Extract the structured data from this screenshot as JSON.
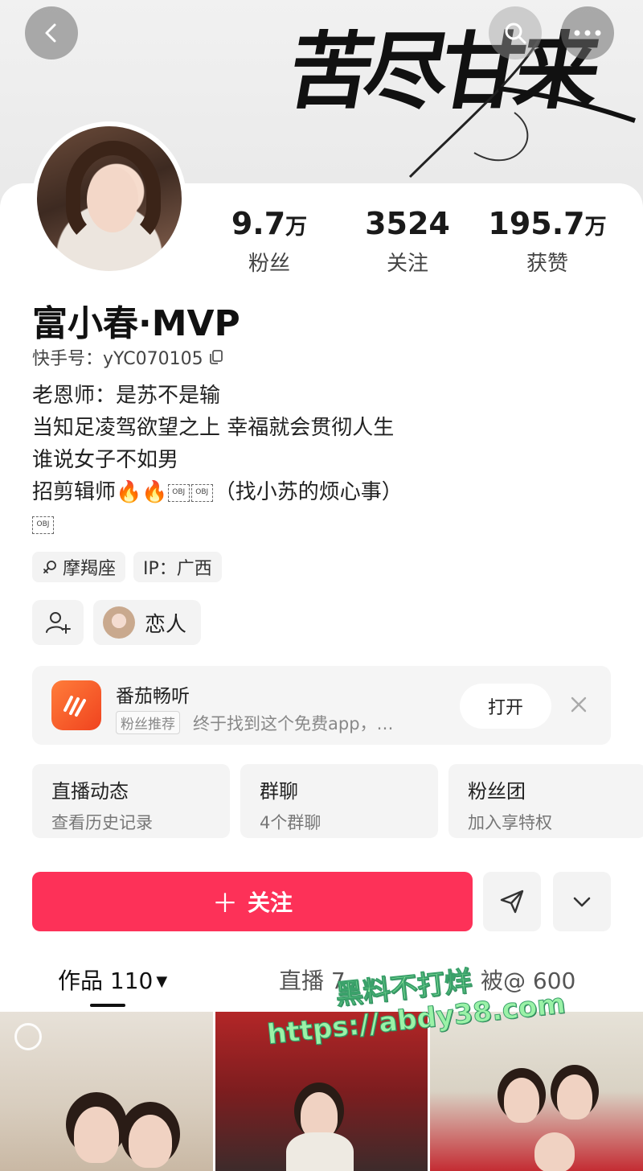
{
  "banner": {
    "calligraphy": "苦尽甘来"
  },
  "profile": {
    "name": "富小春·MVP",
    "kuaishou_id": "快手号：yYC070105",
    "stats": [
      {
        "value": "9.7",
        "unit": "万",
        "label": "粉丝"
      },
      {
        "value": "3524",
        "unit": "",
        "label": "关注"
      },
      {
        "value": "195.7",
        "unit": "万",
        "label": "获赞"
      }
    ],
    "bio": {
      "line1": "老恩师：是苏不是输",
      "line2": "当知足凌驾欲望之上 幸福就会贯彻人生",
      "line3": "谁说女子不如男",
      "line4": "招剪辑师🔥🔥",
      "line4_tail": "（找小苏的烦心事）",
      "obj_placeholder": "OBJ"
    },
    "tags": {
      "zodiac": "摩羯座",
      "ip": "IP：广西"
    },
    "relation_label": "恋人"
  },
  "ad": {
    "title": "番茄畅听",
    "badge": "粉丝推荐",
    "desc": "终于找到这个免费app，…",
    "open_label": "打开"
  },
  "features": [
    {
      "title": "直播动态",
      "subtitle": "查看历史记录"
    },
    {
      "title": "群聊",
      "subtitle": "4个群聊"
    },
    {
      "title": "粉丝团",
      "subtitle": "加入享特权"
    }
  ],
  "actions": {
    "follow_label": "关注",
    "follow_plus": "＋"
  },
  "tabs": {
    "works": "作品 110",
    "live": "直播 7",
    "mentioned": "被@ 600"
  },
  "watermark": {
    "line1": "黑料不打烊",
    "line2": "https://abdy38.com"
  },
  "colors": {
    "accent": "#fd3158",
    "watermark": "#9bf2a7",
    "ad_logo": "#f0431f"
  }
}
